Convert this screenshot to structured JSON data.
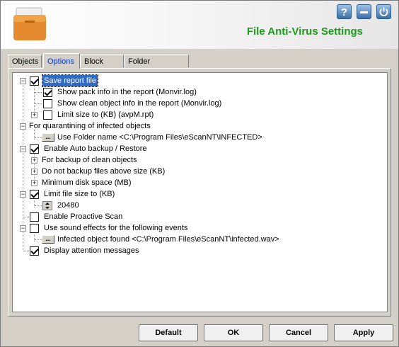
{
  "header": {
    "title": "File Anti-Virus Settings",
    "help_label": "?",
    "colors": {
      "title": "#1e9a1e",
      "buttons": "#3d6ea6"
    }
  },
  "tabs": [
    {
      "label": "Objects",
      "active": false
    },
    {
      "label": "Options",
      "active": true
    },
    {
      "label": "Block Files",
      "active": false
    },
    {
      "label": "Folder Protection",
      "active": false
    }
  ],
  "tree": {
    "items": [
      {
        "label": "Save report file",
        "checked": true,
        "expanded": true,
        "selected": true
      },
      {
        "label": "Show pack info in the report (Monvir.log)",
        "checked": true
      },
      {
        "label": "Show clean object info in the report (Monvir.log)",
        "checked": false
      },
      {
        "label": "Limit size to (KB) (avpM.rpt)",
        "checked": false,
        "collapsed": true
      },
      {
        "label": "For quarantining of infected objects",
        "expanded": true
      },
      {
        "label": "Use Folder name <C:\\Program Files\\eScanNT\\INFECTED>",
        "browse": "..."
      },
      {
        "label": "Enable Auto backup / Restore",
        "checked": true,
        "expanded": true
      },
      {
        "label": "For backup of clean objects",
        "collapsed": true
      },
      {
        "label": "Do not backup files above size (KB)",
        "collapsed": true
      },
      {
        "label": "Minimum disk space (MB)",
        "collapsed": true
      },
      {
        "label": "Limit file size to (KB)",
        "checked": true,
        "expanded": true
      },
      {
        "label": "20480",
        "spinner": true
      },
      {
        "label": "Enable Proactive Scan",
        "checked": false
      },
      {
        "label": "Use sound effects for the following events",
        "checked": false,
        "expanded": true
      },
      {
        "label": "Infected object found <C:\\Program Files\\eScanNT\\infected.wav>",
        "browse": "..."
      },
      {
        "label": "Display attention messages",
        "checked": true
      }
    ]
  },
  "buttons": {
    "default": "Default",
    "ok": "OK",
    "cancel": "Cancel",
    "apply": "Apply"
  }
}
